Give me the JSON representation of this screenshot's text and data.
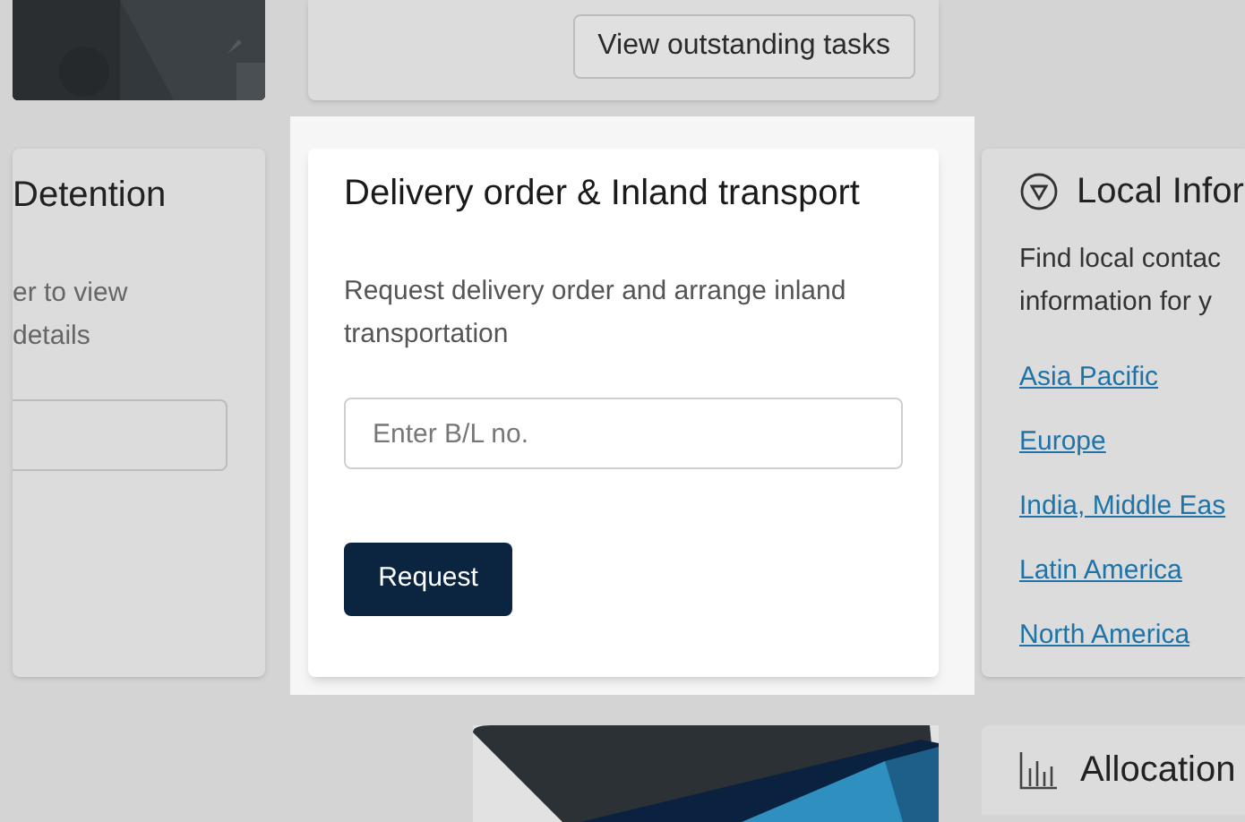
{
  "top_cards": {
    "button": "View outstanding tasks"
  },
  "detention_card": {
    "title": "Detention",
    "description_lines": [
      "er to view",
      "details"
    ]
  },
  "delivery_card": {
    "title": "Delivery order & Inland transport",
    "description": "Request delivery order and arrange inland transportation",
    "input": {
      "placeholder": "Enter B/L no."
    },
    "button": "Request"
  },
  "local_info_card": {
    "title": "Local Infor",
    "description_lines": [
      "Find local contac",
      "information for y"
    ],
    "links": [
      "Asia Pacific",
      "Europe",
      "India, Middle Eas",
      "Latin America",
      "North America"
    ]
  },
  "bottom": {
    "allocation_title": "Allocation"
  }
}
